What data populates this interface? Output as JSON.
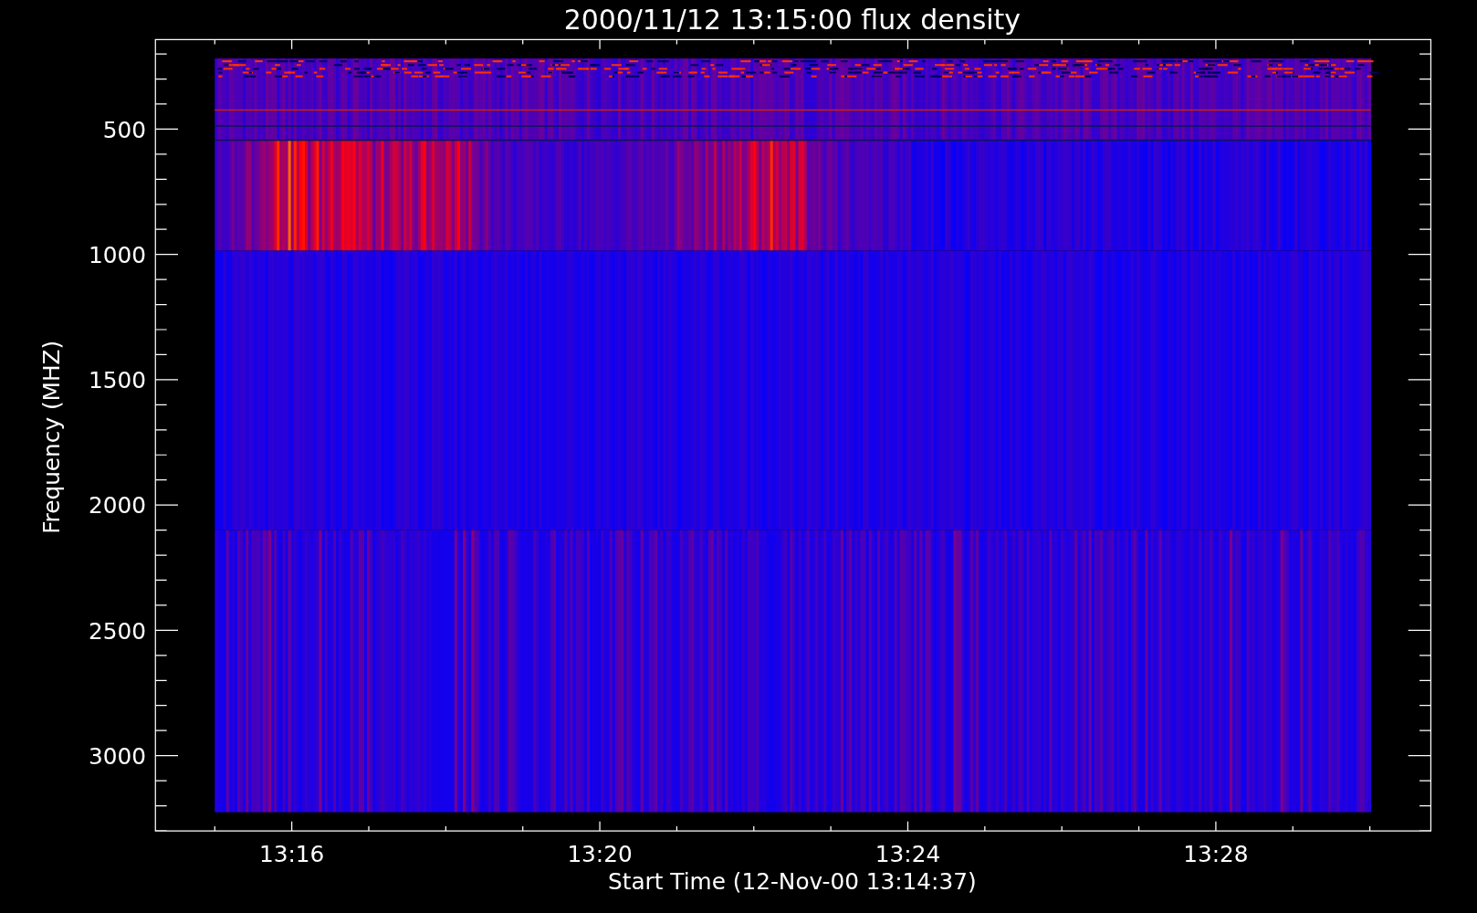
{
  "plot": {
    "title": "2000/11/12 13:15:00 flux density",
    "xlabel": "Start Time (12-Nov-00 13:14:37)",
    "ylabel": "Frequency (MHZ)",
    "xticks": [
      "13:16",
      "13:20",
      "13:24",
      "13:28"
    ],
    "yticks": [
      "500",
      "1000",
      "1500",
      "2000",
      "2500",
      "3000"
    ]
  }
}
